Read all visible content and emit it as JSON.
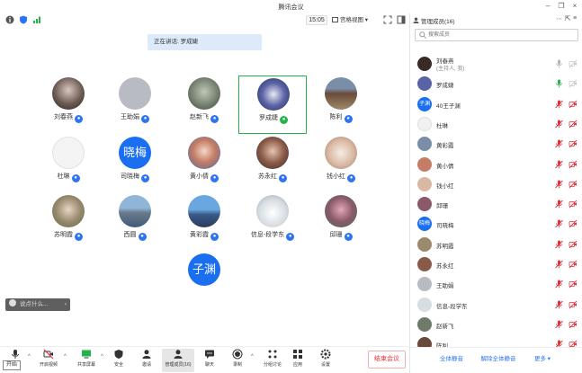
{
  "window": {
    "title": "腾讯会议"
  },
  "topbar": {
    "time": "15:05",
    "view_label": "宫格视图"
  },
  "speaker": {
    "label": "正在讲话: 罗成婕"
  },
  "chat": {
    "placeholder": "说点什么..."
  },
  "tiles": [
    {
      "name": "刘春燕",
      "avatar_text": "",
      "mic": "on"
    },
    {
      "name": "王助娟",
      "avatar_text": "",
      "mic": "on"
    },
    {
      "name": "赵新飞",
      "avatar_text": "",
      "mic": "on"
    },
    {
      "name": "罗成婕",
      "avatar_text": "",
      "mic": "speaking"
    },
    {
      "name": "陈利",
      "avatar_text": "",
      "mic": "on"
    },
    {
      "name": "杜琳",
      "avatar_text": "",
      "mic": "on"
    },
    {
      "name": "司晓梅",
      "avatar_text": "晓梅",
      "mic": "on"
    },
    {
      "name": "黄小倩",
      "avatar_text": "",
      "mic": "on"
    },
    {
      "name": "苏永红",
      "avatar_text": "",
      "mic": "on"
    },
    {
      "name": "钱小红",
      "avatar_text": "",
      "mic": "on"
    },
    {
      "name": "苏明霞",
      "avatar_text": "",
      "mic": "on"
    },
    {
      "name": "西圆",
      "avatar_text": "",
      "mic": "on"
    },
    {
      "name": "黄彩霞",
      "avatar_text": "",
      "mic": "on"
    },
    {
      "name": "信息-段学东",
      "avatar_text": "",
      "mic": "on"
    },
    {
      "name": "邱珊",
      "avatar_text": "",
      "mic": "on"
    },
    {
      "name": "",
      "avatar_text": "子渊",
      "mic": "none"
    }
  ],
  "toolbar": {
    "start_tip": "开始",
    "items": [
      "",
      "开启视频",
      "共享屏幕",
      "安全",
      "邀请",
      "管理成员(16)",
      "聊天",
      "录制",
      "分组讨论",
      "应用",
      "设置"
    ],
    "end_label": "结束会议"
  },
  "panel": {
    "title": "管理成员(16)",
    "search_placeholder": "搜索成员",
    "members": [
      {
        "name": "刘春燕",
        "sub": "(主持人, 我)",
        "avatar_text": "",
        "mic": "on"
      },
      {
        "name": "罗成婕",
        "sub": "",
        "avatar_text": "",
        "mic": "speaking"
      },
      {
        "name": "40王子渊",
        "sub": "",
        "avatar_text": "子渊",
        "mic": "off"
      },
      {
        "name": "杜琳",
        "sub": "",
        "avatar_text": "",
        "mic": "off"
      },
      {
        "name": "黄彩霞",
        "sub": "",
        "avatar_text": "",
        "mic": "off"
      },
      {
        "name": "黄小倩",
        "sub": "",
        "avatar_text": "",
        "mic": "off"
      },
      {
        "name": "钱小红",
        "sub": "",
        "avatar_text": "",
        "mic": "off"
      },
      {
        "name": "邱珊",
        "sub": "",
        "avatar_text": "",
        "mic": "off"
      },
      {
        "name": "司晓梅",
        "sub": "",
        "avatar_text": "晓梅",
        "mic": "off"
      },
      {
        "name": "苏明霞",
        "sub": "",
        "avatar_text": "",
        "mic": "off"
      },
      {
        "name": "苏永红",
        "sub": "",
        "avatar_text": "",
        "mic": "off"
      },
      {
        "name": "王助娟",
        "sub": "",
        "avatar_text": "",
        "mic": "off"
      },
      {
        "name": "信息-段学东",
        "sub": "",
        "avatar_text": "",
        "mic": "off"
      },
      {
        "name": "赵新飞",
        "sub": "",
        "avatar_text": "",
        "mic": "off"
      },
      {
        "name": "陈利",
        "sub": "",
        "avatar_text": "",
        "mic": "off"
      }
    ],
    "mute_all": "全体静音",
    "unmute_all": "解除全体静音",
    "more": "更多"
  },
  "colors": {
    "accent": "#1a6ff0",
    "speaking": "#26b24a",
    "muted": "#e0303a",
    "danger": "#e33333"
  }
}
